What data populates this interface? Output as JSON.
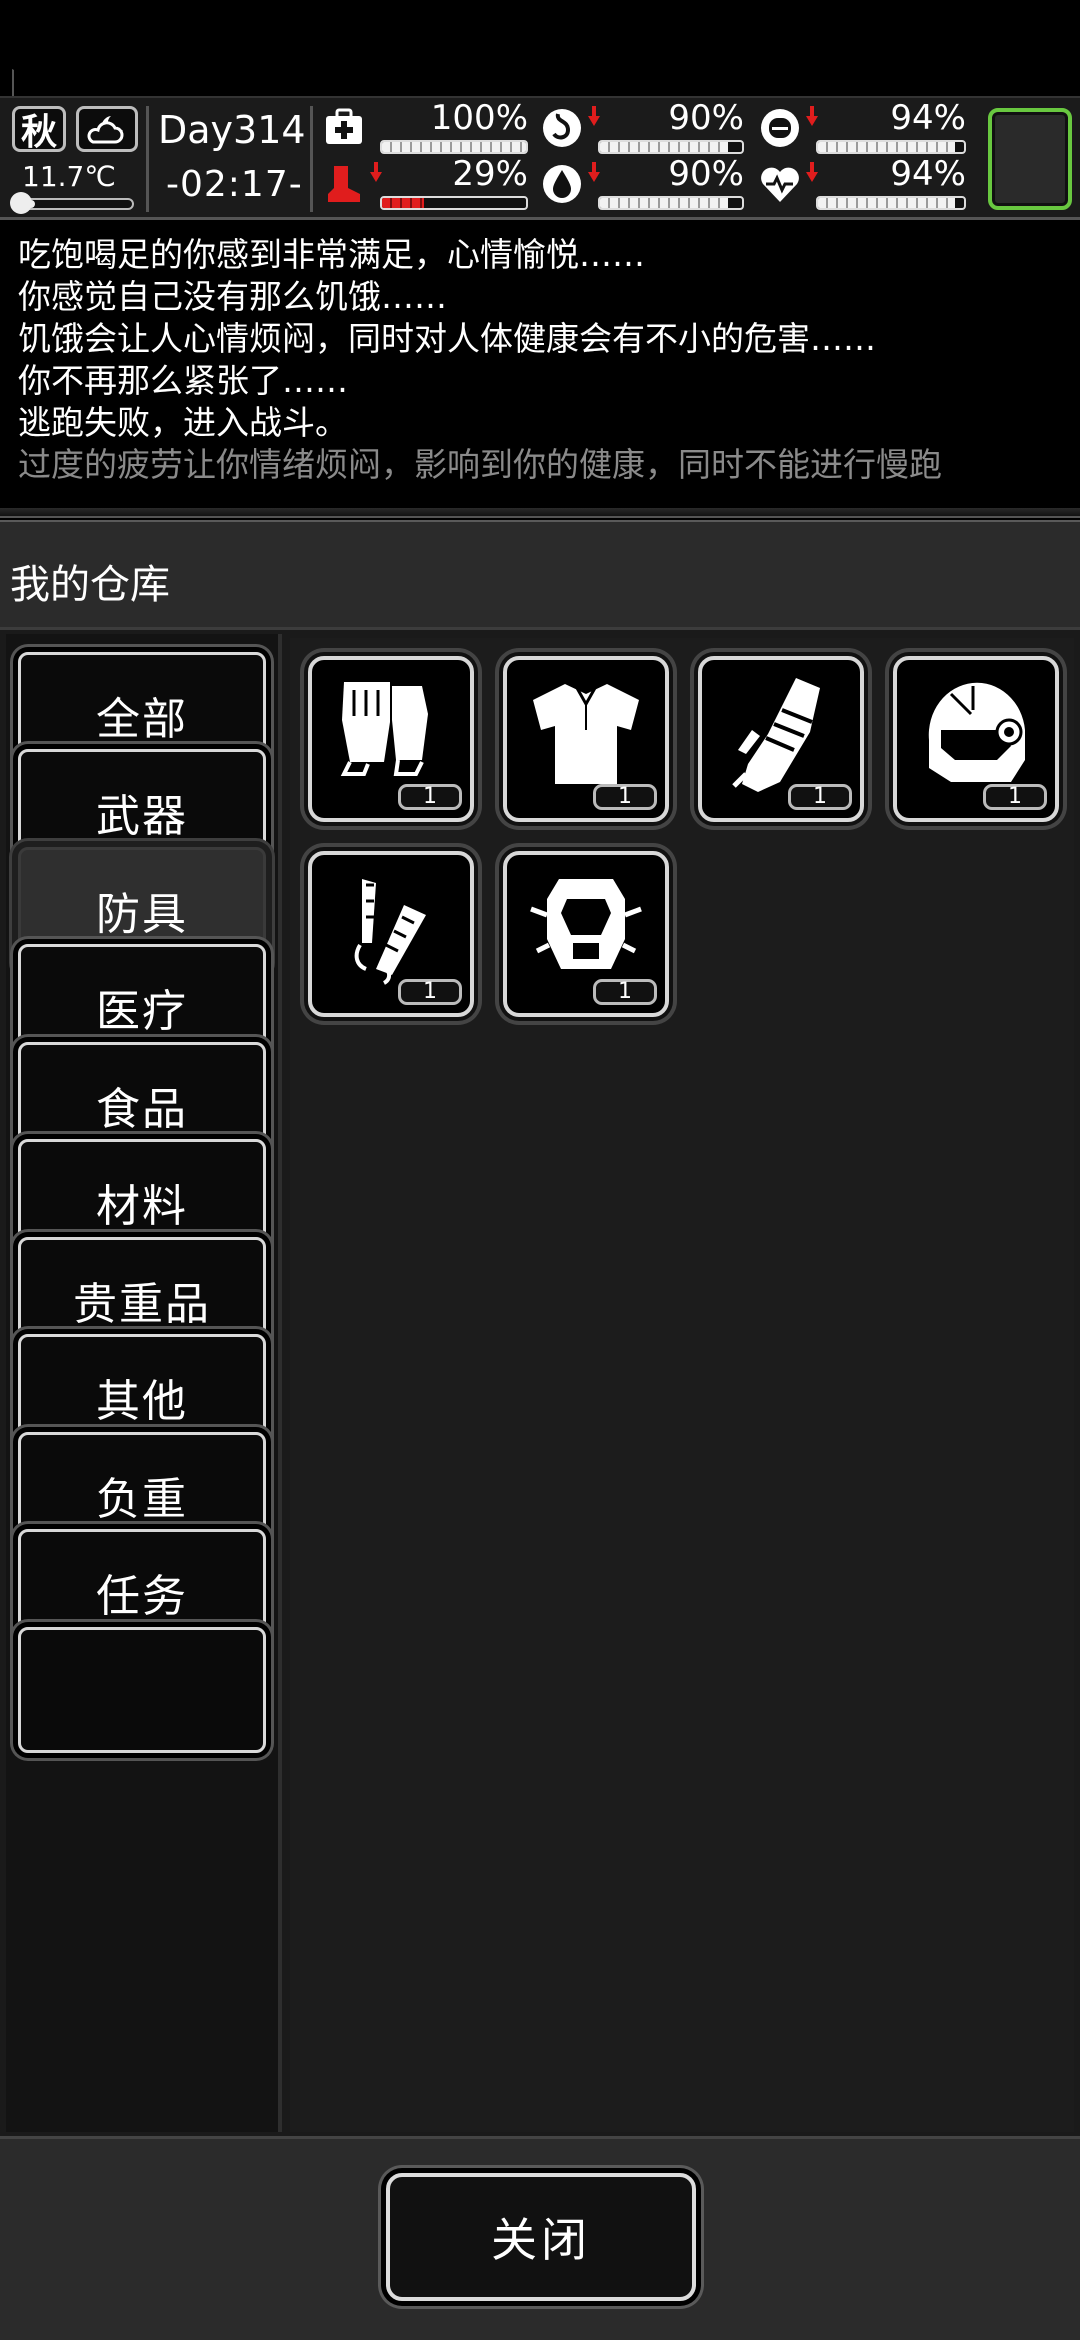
{
  "status": {
    "season": "秋",
    "weather_icon": "cloudy-night-icon",
    "temperature": "11.7℃",
    "temperature_level": 0.15,
    "day": "Day314",
    "time": "-02:17-",
    "stats": [
      {
        "id": "health",
        "icon": "medkit-icon",
        "value": "100%",
        "level": 1.0,
        "trend": "none",
        "color": "#f2f2f2"
      },
      {
        "id": "hunger",
        "icon": "stomach-icon",
        "value": "90%",
        "level": 0.9,
        "trend": "down",
        "color": "#f2f2f2"
      },
      {
        "id": "energy",
        "icon": "capsule-icon",
        "value": "94%",
        "level": 0.94,
        "trend": "down",
        "color": "#f2f2f2"
      },
      {
        "id": "stamina",
        "icon": "boot-icon",
        "value": "29%",
        "level": 0.29,
        "trend": "down",
        "color": "#e01d1d"
      },
      {
        "id": "thirst",
        "icon": "water-drop-icon",
        "value": "90%",
        "level": 0.9,
        "trend": "down",
        "color": "#f2f2f2"
      },
      {
        "id": "mood",
        "icon": "heart-icon",
        "value": "94%",
        "level": 0.94,
        "trend": "down",
        "color": "#f2f2f2"
      }
    ],
    "accent_color": "#69c840",
    "trend_color": "#e01d1d"
  },
  "log": [
    "吃饱喝足的你感到非常满足，心情愉悦……",
    "你感觉自己没有那么饥饿……",
    "饥饿会让人心情烦闷，同时对人体健康会有不小的危害……",
    "你不再那么紧张了……",
    "逃跑失败，进入战斗。",
    "过度的疲劳让你情绪烦闷，影响到你的健康，同时不能进行慢跑"
  ],
  "panel": {
    "title": "我的仓库",
    "categories": [
      "全部",
      "武器",
      "防具",
      "医疗",
      "食品",
      "材料",
      "贵重品",
      "其他",
      "负重",
      "任务"
    ],
    "active_category": "防具",
    "items": [
      {
        "icon": "fingerless-gloves-icon",
        "qty": "1"
      },
      {
        "icon": "shirt-icon",
        "qty": "1"
      },
      {
        "icon": "armored-gauntlet-icon",
        "qty": "1"
      },
      {
        "icon": "tactical-helmet-icon",
        "qty": "1"
      },
      {
        "icon": "arm-guard-icon",
        "qty": "1"
      },
      {
        "icon": "body-armor-vest-icon",
        "qty": "1"
      }
    ]
  },
  "footer": {
    "close_label": "关闭"
  }
}
